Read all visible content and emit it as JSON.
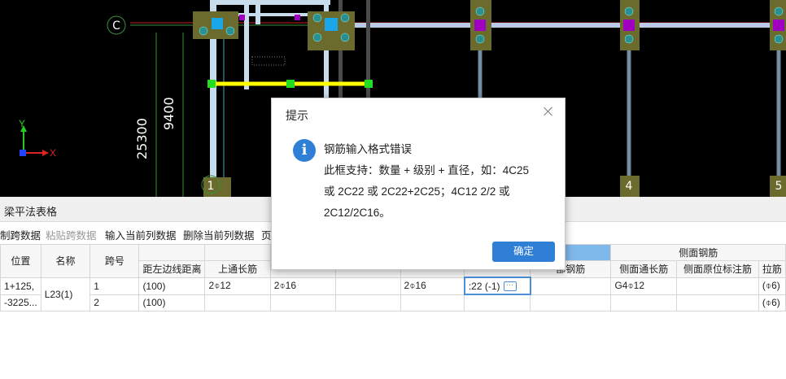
{
  "cad": {
    "axis_label_c": "C",
    "axis_label_1": "1",
    "axis_label_4": "4",
    "axis_label_5": "5",
    "dim_9400": "9400",
    "dim_25300": "25300",
    "axis_x": "X",
    "axis_y": "Y"
  },
  "panel": {
    "title": "梁平法表格"
  },
  "toolbar": {
    "copy_span": "制跨数据",
    "paste_span": "粘贴跨数据",
    "input_column": "输入当前列数据",
    "delete_column": "删除当前列数据",
    "page": "页"
  },
  "table": {
    "group_header_side": "侧面钢筋",
    "headers": {
      "position": "位置",
      "name": "名称",
      "span": "跨号",
      "left_dist": "距左边线距离",
      "top_long": "上通长筋",
      "bottom_partial": "部钢筋",
      "side_long": "侧面通长筋",
      "side_orig": "侧面原位标注筋",
      "tie": "拉筋"
    },
    "rows": [
      {
        "position": "1+125,",
        "name": "L23(1)",
        "span": "1",
        "left_dist": "(100)",
        "top_long": "2⌽12",
        "col6": "2⌽16",
        "col8": "2⌽16",
        "edit": ":22 (-1)",
        "side_long": "G4⌽12",
        "tie": "(⌽6)"
      },
      {
        "position": "-3225...",
        "name": "",
        "span": "2",
        "left_dist": "(100)",
        "top_long": "",
        "col6": "",
        "col8": "",
        "edit": "",
        "side_long": "",
        "tie": "(⌽6)"
      }
    ]
  },
  "dialog": {
    "title": "提示",
    "heading": "钢筋输入格式错误",
    "line1": "此框支持：数量 + 级别 + 直径，如：4C25",
    "line2": "或 2C22 或 2C22+2C25；4C12 2/2 或",
    "line3": "2C12/2C16。",
    "ok_label": "确定"
  },
  "colors": {
    "accent": "#2f7fd6",
    "cad_bg": "#000000",
    "beam_yellow": "#ffff00",
    "column_olive": "#6b6b2e",
    "magenta": "#a000c0"
  }
}
